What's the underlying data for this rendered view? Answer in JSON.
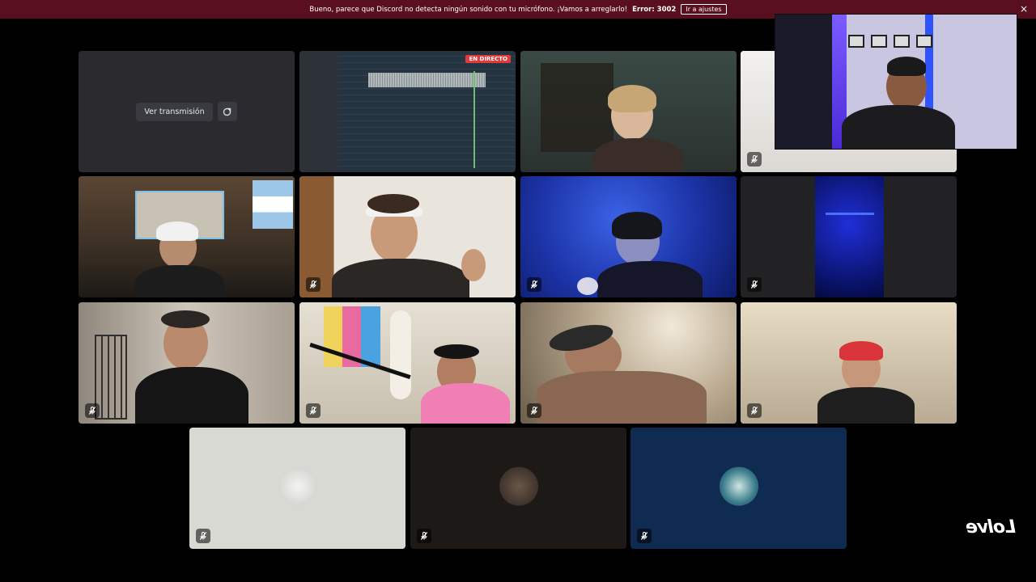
{
  "banner": {
    "message": "Bueno, parece que Discord no detecta ningún sonido con tu micrófono. ¡Vamos a arreglarlo!",
    "error": "Error: 3002",
    "button": "Ir a ajustes",
    "close": "×"
  },
  "stream_tile": {
    "watch_label": "Ver transmisión",
    "popout_icon": "popout-stream-icon"
  },
  "live_badge": "EN DIRECTO",
  "icons": {
    "muted": "mic-muted-icon"
  },
  "logo_text": "Lolve",
  "colors": {
    "banner_bg": "#5a0f1e",
    "live_red": "#e03a3a",
    "tile_dark": "#2b2b2f"
  }
}
